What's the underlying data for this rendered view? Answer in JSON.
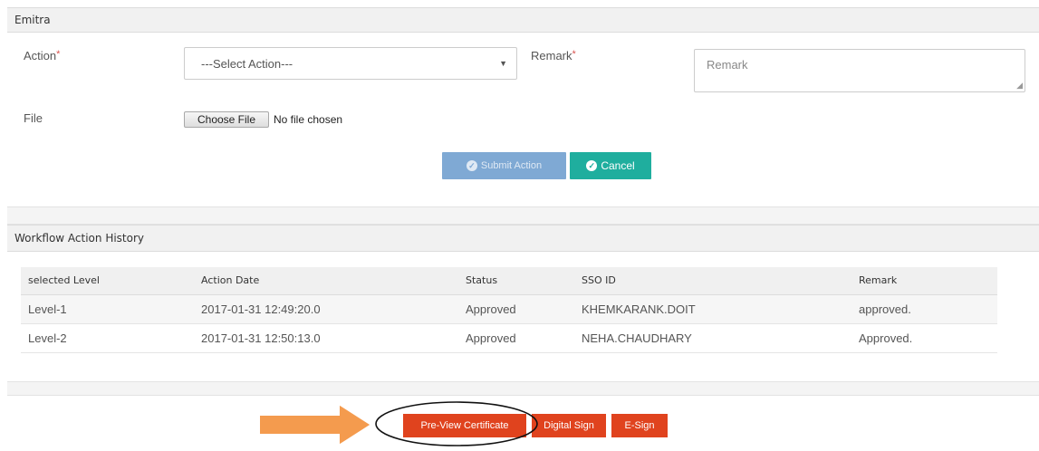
{
  "emitra_panel": {
    "title": "Emitra",
    "action_label": "Action",
    "required_mark": "*",
    "action_select_value": "---Select Action---",
    "remark_label": "Remark",
    "remark_placeholder": "Remark",
    "file_label": "File",
    "file_button": "Choose File",
    "file_status": "No file chosen",
    "submit_label": "Submit Action",
    "cancel_label": "Cancel"
  },
  "history_panel": {
    "title": "Workflow Action History",
    "columns": [
      "selected Level",
      "Action Date",
      "Status",
      "SSO ID",
      "Remark"
    ],
    "rows": [
      [
        "Level-1",
        "2017-01-31 12:49:20.0",
        "Approved",
        "KHEMKARANK.DOIT",
        "approved."
      ],
      [
        "Level-2",
        "2017-01-31 12:50:13.0",
        "Approved",
        "NEHA.CHAUDHARY",
        "Approved."
      ]
    ]
  },
  "footer_buttons": {
    "preview": "Pre-View Certificate",
    "digital_sign": "Digital Sign",
    "esign": "E-Sign"
  },
  "colors": {
    "accent_orange": "#e0431e",
    "cancel_teal": "#1fae9e",
    "submit_blue": "#7fa9d4",
    "annotation_arrow": "#f49b4e"
  }
}
